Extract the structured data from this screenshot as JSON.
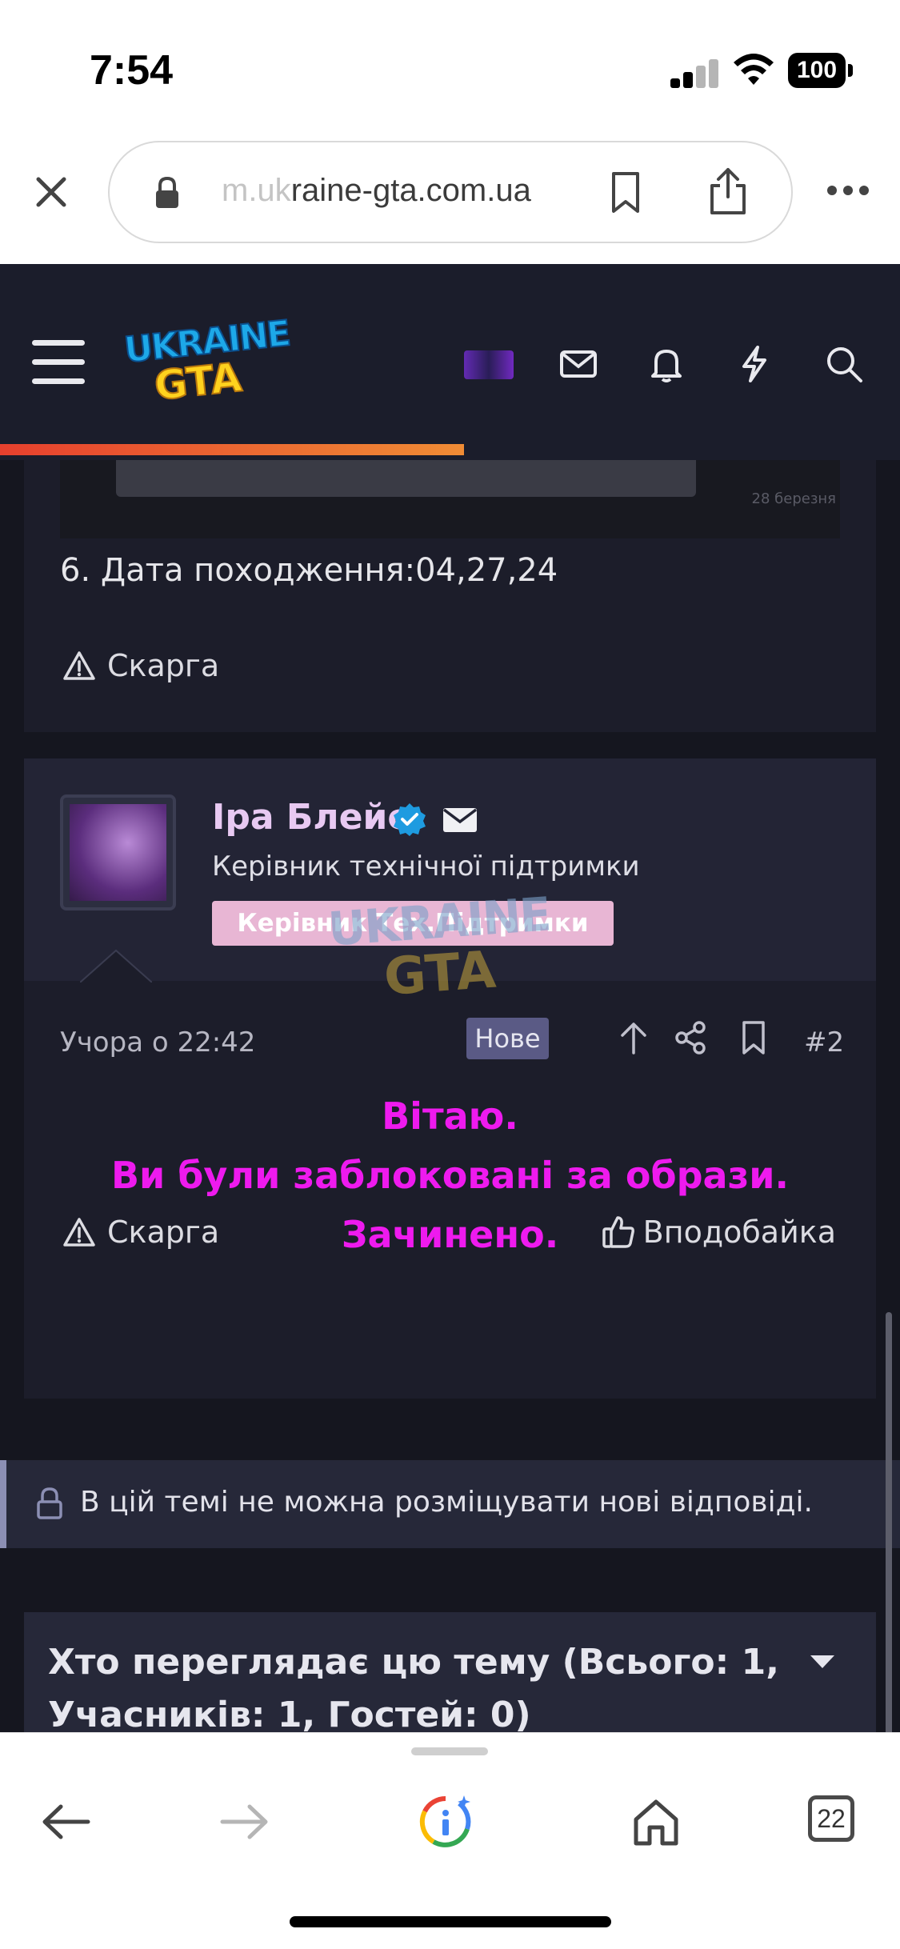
{
  "status_bar": {
    "time": "7:54",
    "battery": "100"
  },
  "browser": {
    "url_prefix": "m.uk",
    "url_rest": "raine-gta.com.ua",
    "tabs_count": "22"
  },
  "forum": {
    "logo": {
      "line1": "UKRAINE",
      "line2": "GTA"
    },
    "colors": {
      "header_bg": "#1b1d2b",
      "accent_progress": "#e6402e",
      "message_color": "#ee1aee"
    }
  },
  "post1": {
    "image_date": "28 березня",
    "text": "6. Дата походження:04,27,24",
    "report_label": "Скарга"
  },
  "post2": {
    "username": "Іра Блейс",
    "user_title": "Керівник технічної підтримки",
    "user_banner": "Керівник Тех.Підтримки",
    "watermark_line1": "UKRAINE",
    "watermark_line2": "GTA",
    "date": "Учора о 22:42",
    "new_badge": "Нове",
    "post_number": "#2",
    "message_lines": [
      "Вітаю.",
      "Ви були заблоковані за образи.",
      "Зачинено."
    ],
    "report_label": "Скарга",
    "like_label": "Вподобайка"
  },
  "closed_notice": "В цій темі не можна розміщувати нові відповіді.",
  "viewers_title": "Хто переглядає цю тему (Всього: 1, Учасників: 1, Гостей: 0)"
}
